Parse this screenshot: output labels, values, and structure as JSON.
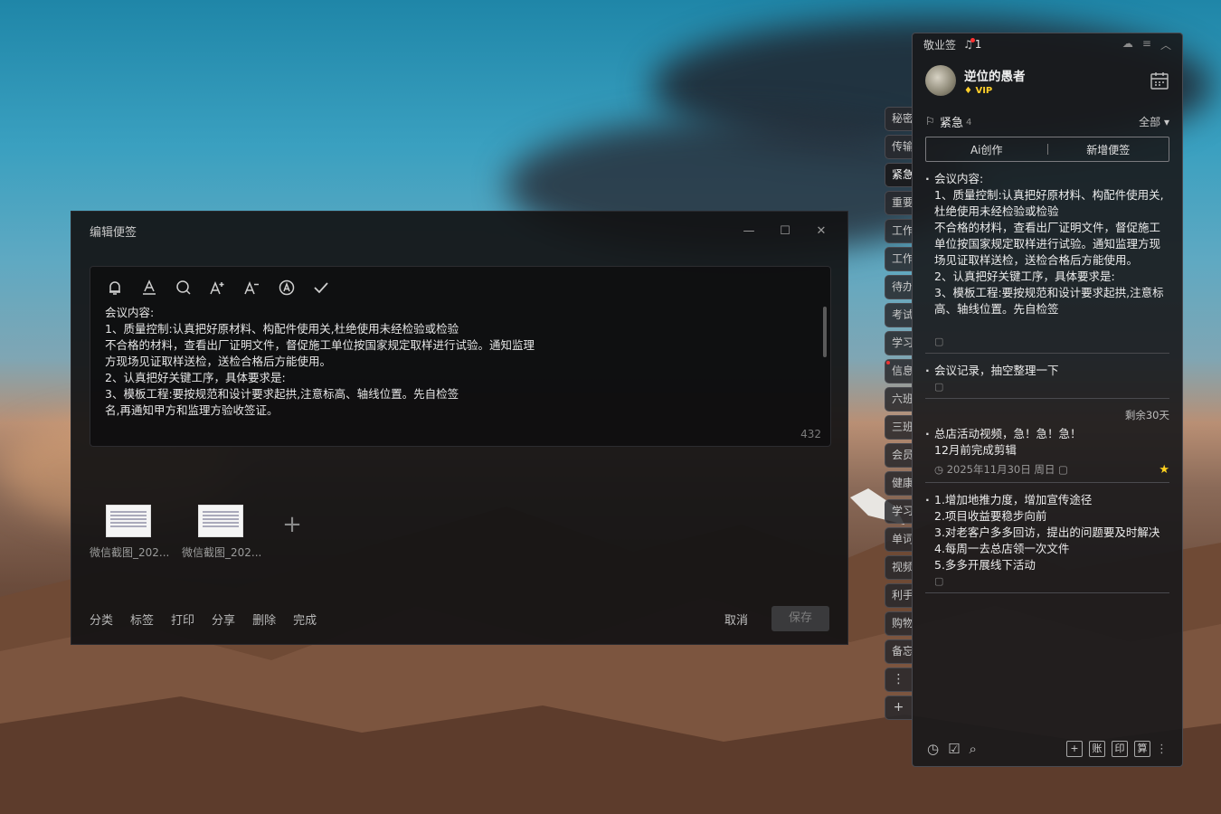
{
  "editor": {
    "title": "编辑便签",
    "window_controls": {
      "minimize": "—",
      "maximize": "☐",
      "close": "✕"
    },
    "toolbar_icons": [
      "bell-icon",
      "text-color-icon",
      "search-icon",
      "font-increase-icon",
      "font-decrease-icon",
      "auto-format-icon",
      "check-icon"
    ],
    "content": "会议内容:\n1、质量控制:认真把好原材料、构配件使用关,杜绝使用未经检验或检验\n不合格的材料，查看出厂证明文件，督促施工单位按国家规定取样进行试验。通知监理\n方现场见证取样送检，送检合格后方能使用。\n2、认真把好关键工序，具体要求是:\n3、模板工程:要按规范和设计要求起拱,注意标高、轴线位置。先自检签\n名,再通知甲方和监理方验收签证。",
    "char_count": "432",
    "attachments": [
      {
        "name": "微信截图_202..."
      },
      {
        "name": "微信截图_202..."
      }
    ],
    "add_attachment": "+",
    "actions": [
      "分类",
      "标签",
      "打印",
      "分享",
      "删除",
      "完成"
    ],
    "cancel": "取消",
    "save": "保存"
  },
  "side_tabs": {
    "items": [
      "秘密",
      "传输",
      "紧急",
      "重要",
      "工作",
      "工作",
      "待办",
      "考试",
      "学习",
      "信息",
      "六班",
      "三班",
      "会员",
      "健康",
      "学习",
      "单词",
      "视频",
      "利手",
      "购物",
      "备忘"
    ],
    "active_index": 2,
    "more": "⋮",
    "add": "+"
  },
  "panel": {
    "app_name": "敬业签",
    "bell_count": "1",
    "user": {
      "name": "逆位的愚者",
      "vip": "VIP"
    },
    "section": {
      "title": "紧急",
      "count": "4",
      "filter": "全部 ▾"
    },
    "buttons": {
      "ai": "Ai创作",
      "new": "新增便签"
    },
    "notes": [
      {
        "text": "会议内容:\n1、质量控制:认真把好原材料、构配件使用关,杜绝使用未经检验或检验\n不合格的材料，查看出厂证明文件，督促施工单位按国家规定取样进行试验。通知监理方现场见证取样送检，送检合格后方能使用。\n2、认真把好关键工序，具体要求是:\n3、模板工程:要按规范和设计要求起拱,注意标高、轴线位置。先自检签"
      },
      {
        "text": "会议记录，抽空整理一下"
      },
      {
        "remaining": "剩余30天",
        "text": "总店活动视频，急！急！急！\n12月前完成剪辑",
        "date": "2025年11月30日 周日"
      },
      {
        "text": "1.增加地推力度，增加宣传途径\n2.项目收益要稳步向前\n3.对老客户多多回访，提出的问题要及时解决\n4.每周一去总店领一次文件\n5.多多开展线下活动"
      }
    ],
    "bottom_right": [
      "+",
      "账",
      "印",
      "算"
    ]
  }
}
